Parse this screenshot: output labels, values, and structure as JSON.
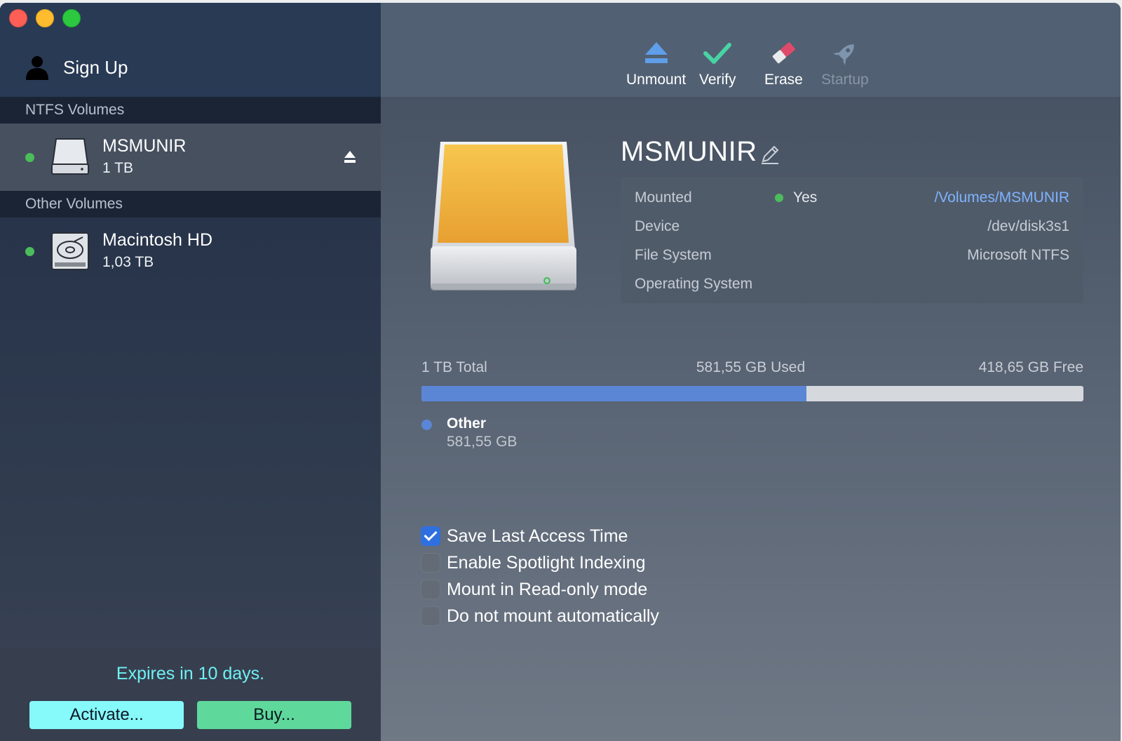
{
  "sidebar": {
    "signup_label": "Sign Up",
    "sections": {
      "ntfs": "NTFS Volumes",
      "other": "Other Volumes"
    },
    "volumes": [
      {
        "name": "MSMUNIR",
        "size": "1 TB",
        "status_color": "#4bbd5a",
        "icon": "external-drive-icon",
        "selected": true
      },
      {
        "name": "Macintosh HD",
        "size": "1,03 TB",
        "status_color": "#4bbd5a",
        "icon": "internal-hard-drive-icon",
        "selected": false
      }
    ],
    "footer": {
      "expires": "Expires in 10 days.",
      "activate_label": "Activate...",
      "buy_label": "Buy..."
    }
  },
  "toolbar": {
    "unmount": "Unmount",
    "verify": "Verify",
    "erase": "Erase",
    "startup": "Startup"
  },
  "detail": {
    "title": "MSMUNIR",
    "info": {
      "mounted_label": "Mounted",
      "mounted_value": "Yes",
      "mount_path": "/Volumes/MSMUNIR",
      "device_label": "Device",
      "device_value": "/dev/disk3s1",
      "filesystem_label": "File System",
      "filesystem_value": "Microsoft NTFS",
      "os_label": "Operating System"
    },
    "capacity": {
      "total": "1 TB Total",
      "used": "581,55 GB Used",
      "free": "418,65 GB Free",
      "used_fraction": 0.5815,
      "legend_name": "Other",
      "legend_size": "581,55 GB"
    },
    "options": [
      {
        "label": "Save Last Access Time",
        "checked": true
      },
      {
        "label": "Enable Spotlight Indexing",
        "checked": false
      },
      {
        "label": "Mount in Read-only mode",
        "checked": false
      },
      {
        "label": "Do not mount automatically",
        "checked": false
      }
    ]
  },
  "colors": {
    "accent_blue": "#5b86d6",
    "status_green": "#4bbd5a",
    "expires_cyan": "#6ff0f5",
    "activate_bg": "#86f9fb",
    "buy_bg": "#5fd89b",
    "link_blue": "#7fb3ff"
  }
}
